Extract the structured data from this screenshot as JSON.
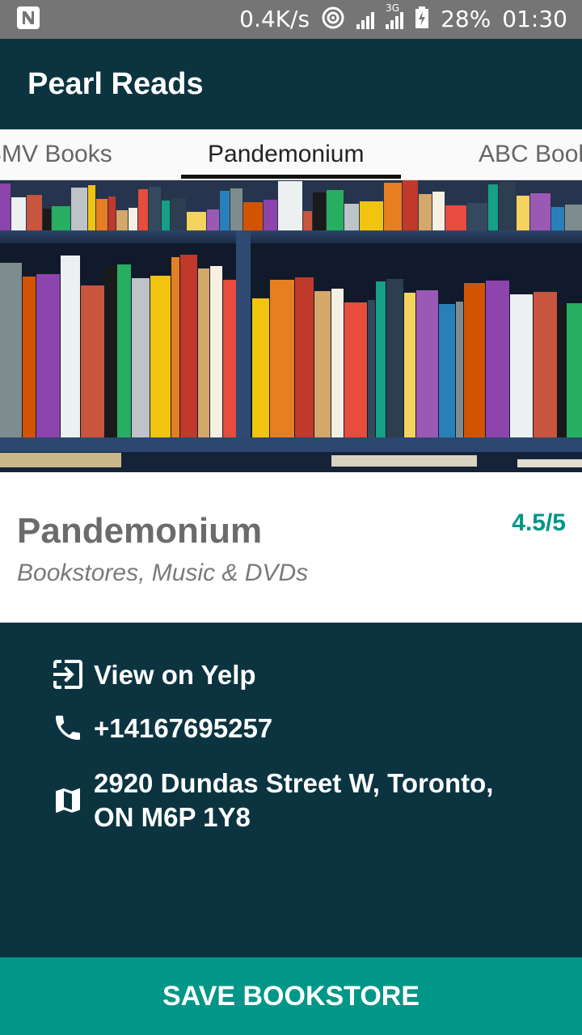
{
  "status_bar": {
    "network_speed": "0.4K/s",
    "network_type": "3G",
    "battery": "28%",
    "time": "01:30",
    "icons": [
      "n-notification-icon",
      "hotspot-icon",
      "signal-icon",
      "signal-3g-icon",
      "battery-charging-icon"
    ]
  },
  "app_bar": {
    "title": "Pearl Reads"
  },
  "tabs": {
    "items": [
      {
        "label": "BMV Books"
      },
      {
        "label": "Pandemonium"
      },
      {
        "label": "ABC Books"
      }
    ],
    "active_index": 1
  },
  "hero": {
    "description": "bookshelf photo"
  },
  "store": {
    "name": "Pandemonium",
    "categories": "Bookstores, Music & DVDs",
    "rating": "4.5/5"
  },
  "details": {
    "yelp_label": "View on Yelp",
    "phone": "+14167695257",
    "address": "2920 Dundas Street W, Toronto, ON M6P 1Y8"
  },
  "actions": {
    "save_label": "SAVE BOOKSTORE"
  },
  "colors": {
    "status_bar": "#757575",
    "primary_dark": "#0b3440",
    "accent": "#009688",
    "name_gray": "#6b6b6b"
  }
}
